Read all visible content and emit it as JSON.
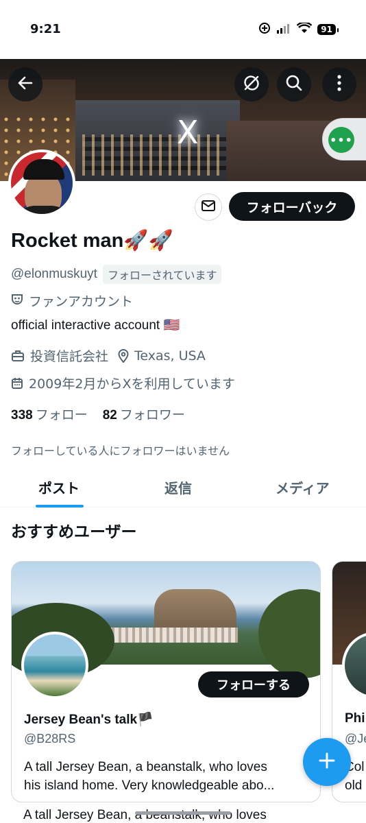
{
  "status_bar": {
    "time": "9:21",
    "battery": "91"
  },
  "profile": {
    "name": "Rocket man🚀🚀",
    "handle": "@elonmuskuyt",
    "follows_you": "フォローされています",
    "label": "ファンアカウント",
    "bio": "official interactive account 🇺🇸",
    "profession": "投資信託会社",
    "location": "Texas, USA",
    "joined": "2009年2月からXを利用しています",
    "following_count": "338",
    "following_label": "フォロー",
    "followers_count": "82",
    "followers_label": "フォロワー",
    "mutual_note": "フォローしている人にフォロワーはいません",
    "followback_label": "フォローバック",
    "banner_logo": "X"
  },
  "tabs": [
    {
      "label": "ポスト",
      "active": true
    },
    {
      "label": "返信",
      "active": false
    },
    {
      "label": "メディア",
      "active": false
    }
  ],
  "recommended": {
    "title": "おすすめユーザー",
    "cards": [
      {
        "name": "Jersey Bean's talk",
        "flag": "🏴",
        "handle": "@B28RS",
        "follow_label": "フォローする",
        "description_1": "A tall Jersey Bean, a beanstalk, who loves",
        "description_2": "his island home. Very knowledgeable abo..."
      },
      {
        "name": "Phi",
        "handle": "@Je",
        "description_1": "Col",
        "description_2": "old"
      }
    ],
    "peek_text": "A tall Jersey Bean, a beanstalk, who loves"
  },
  "icons": {
    "back": "back-arrow-icon",
    "refresh": "no-sync-icon",
    "search": "search-icon",
    "more": "more-vertical-icon",
    "mail": "mail-icon",
    "label": "mask-icon",
    "profession": "briefcase-icon",
    "location": "location-pin-icon",
    "joined": "calendar-icon",
    "compose": "plus-icon"
  },
  "colors": {
    "accent": "#1d9bf0",
    "text": "#0f1419",
    "muted": "#536471",
    "more_bubble": "#1fa14d"
  }
}
